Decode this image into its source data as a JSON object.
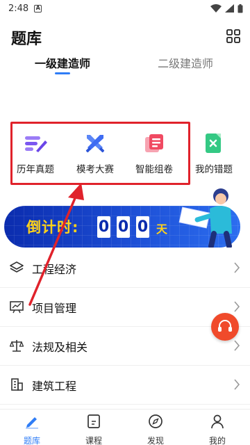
{
  "status_bar": {
    "time": "2:48"
  },
  "header": {
    "title": "题库"
  },
  "tabs": [
    {
      "label": "一级建造师",
      "active": true
    },
    {
      "label": "二级建造师",
      "active": false
    }
  ],
  "tools": [
    {
      "label": "历年真题",
      "icon": "pen-lines-icon",
      "color": "#7b57f0"
    },
    {
      "label": "模考大赛",
      "icon": "crossed-swords-icon",
      "color": "#4a78f6"
    },
    {
      "label": "智能组卷",
      "icon": "stacked-papers-icon",
      "color": "#f04a62"
    },
    {
      "label": "我的错题",
      "icon": "error-book-icon",
      "color": "#2fc27a"
    }
  ],
  "banner": {
    "label": "倒计时:",
    "digits": [
      "0",
      "0",
      "0"
    ],
    "unit": "天",
    "colors": {
      "background": "#1d4fd6",
      "text": "#ffd21a"
    }
  },
  "subjects": [
    {
      "label": "工程经济",
      "icon": "layers-icon"
    },
    {
      "label": "项目管理",
      "icon": "chart-board-icon"
    },
    {
      "label": "法规及相关",
      "icon": "scales-icon"
    },
    {
      "label": "建筑工程",
      "icon": "building-icon"
    }
  ],
  "bottom_nav": [
    {
      "label": "题库",
      "icon": "pencil-icon",
      "active": true
    },
    {
      "label": "课程",
      "icon": "course-book-icon",
      "active": false
    },
    {
      "label": "发现",
      "icon": "compass-icon",
      "active": false
    },
    {
      "label": "我的",
      "icon": "user-icon",
      "active": false
    }
  ],
  "accent_color": "#2f7df6",
  "annotation_color": "#e0222b"
}
